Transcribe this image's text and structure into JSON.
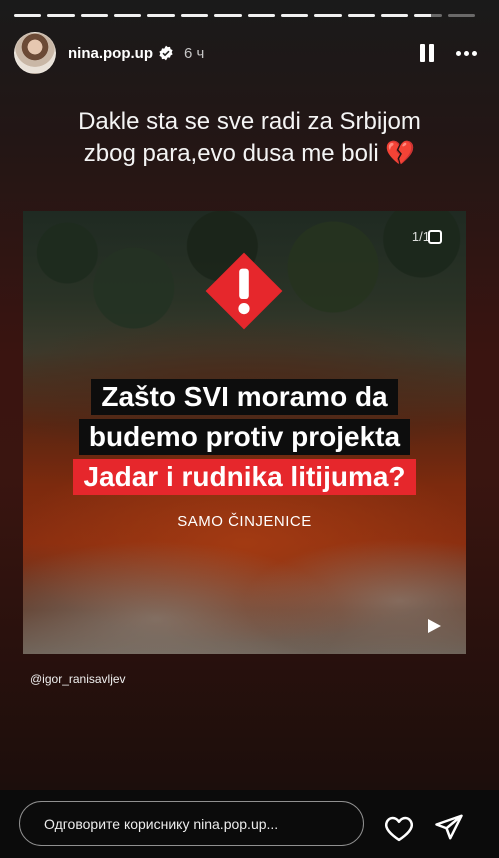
{
  "story": {
    "progress_segments": 14,
    "progress_done": 12,
    "current_segment_progress": 0.6
  },
  "header": {
    "username": "nina.pop.up",
    "time": "6 ч",
    "verified": true
  },
  "caption": {
    "line1": "Dakle sta se sve radi za Srbijom",
    "line2": "zbog para,evo dusa me boli 💔"
  },
  "post": {
    "counter": "1/1",
    "headline_line1": "Zašto SVI moramo da",
    "headline_line2": "budemo protiv projekta",
    "headline_line3": "Jadar i rudnika litijuma?",
    "subtitle": "SAMO ČINJENICE",
    "mention": "@igor_ranisavljev"
  },
  "footer": {
    "reply_placeholder": "Одговорите кориснику nina.pop.up..."
  },
  "colors": {
    "accent_red": "#e6272c",
    "headline_bg": "#0d0d0d",
    "verified_blue": "#3897f0"
  },
  "icons": {
    "warning": "warning-diamond-icon",
    "pause": "pause-icon",
    "more": "more-icon",
    "heart": "heart-icon",
    "send": "send-icon",
    "play": "play-icon"
  }
}
